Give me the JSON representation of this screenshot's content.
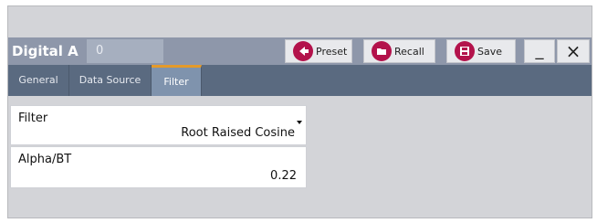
{
  "window": {
    "title": "Digital A",
    "badge": "0",
    "preset_label": "Preset",
    "recall_label": "Recall",
    "save_label": "Save",
    "minimize_label": "_",
    "close_label": "×"
  },
  "tabs": [
    {
      "label": "General"
    },
    {
      "label": "Data Source"
    },
    {
      "label": "Filter",
      "active": true
    }
  ],
  "fields": {
    "filter": {
      "label": "Filter",
      "value": "Root Raised Cosine"
    },
    "alpha_bt": {
      "label": "Alpha/BT",
      "value": "0.22"
    }
  },
  "colors": {
    "accent": "#b3124b",
    "active_tab_indicator": "#e49a2a",
    "tab_bar": "#5a6a80",
    "title_bar": "#8e97aa"
  },
  "icons": [
    "preset-icon",
    "recall-icon",
    "save-icon"
  ]
}
